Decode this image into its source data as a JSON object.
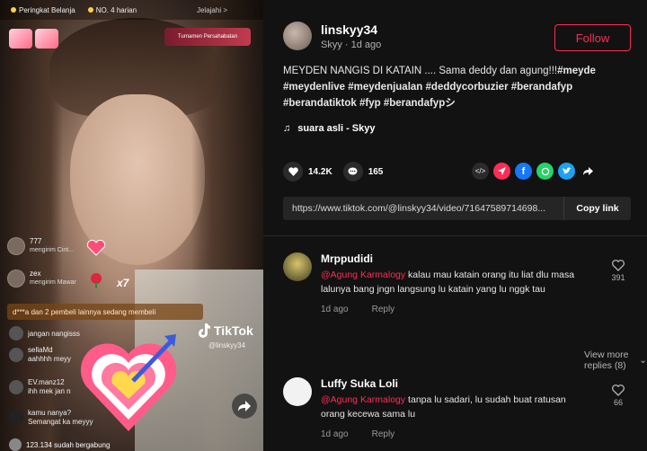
{
  "live": {
    "top_chip_1": "Peringkat Belanja",
    "top_chip_2": "NO. 4 harian",
    "top_chip_3": "Jelajahi >",
    "tournament": "Turnamen Persahabatan",
    "chat": [
      {
        "name": "777",
        "sub": "mengirim Cint..."
      },
      {
        "name": "zex",
        "sub": "mengirim Mawar"
      }
    ],
    "gift_multiplier": "x7",
    "buyers_banner": "d***a dan 2 pembeli lainnya sedang membeli",
    "comments": [
      {
        "name": "",
        "text": "jangan nangisss"
      },
      {
        "name": "sellaMd",
        "text": "aahhhh meyy"
      },
      {
        "name": "EV.manz12",
        "text": "ihh mek jan n"
      },
      {
        "name": "kamu nanya?",
        "text": "Semangat ka meyyy"
      }
    ],
    "joined_text": "123.134 sudah bergabung",
    "watermark_brand": "TikTok",
    "watermark_user": "@linskyy34"
  },
  "post": {
    "username": "linskyy34",
    "meta": "Skyy · 1d ago",
    "follow_label": "Follow",
    "caption_plain": "MEYDEN NANGIS DI KATAIN .... Sama deddy dan agung!!!",
    "hashtags_line1": "#meyde",
    "hashtags_line2": "#meydenlive #meydenjualan #deddycorbuzier #berandafyp",
    "hashtags_line3": "#berandatiktok #fyp #berandafypシ",
    "music": "suara asli - Skyy",
    "likes": "14.2K",
    "comments_count": "165",
    "url": "https://www.tiktok.com/@linskyy34/video/71647589714698...",
    "copy_label": "Copy link"
  },
  "comments": [
    {
      "name": "Mrppudidi",
      "mention": "@Agung Karmalogy",
      "text": " kalau mau katain orang itu liat dlu masa lalunya bang jngn langsung lu katain yang lu nggk tau",
      "time": "1d ago",
      "reply": "Reply",
      "likes": "391"
    },
    {
      "name": "Luffy Suka Loli",
      "mention": "@Agung Karmalogy",
      "text": " tanpa lu sadari, lu sudah buat ratusan orang kecewa sama lu",
      "time": "1d ago",
      "reply": "Reply",
      "likes": "66"
    }
  ],
  "view_more": "View more replies (8)",
  "colors": {
    "accent": "#fe2c55",
    "background": "#121212",
    "facebook": "#1877f2",
    "whatsapp": "#25d366",
    "twitter": "#1da1f2"
  }
}
